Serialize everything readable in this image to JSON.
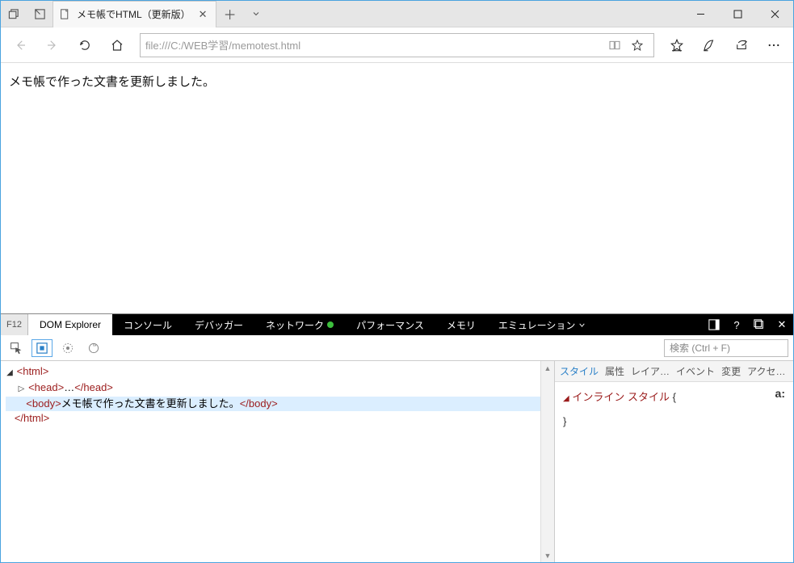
{
  "window": {
    "tab_title": "メモ帳でHTML（更新版）",
    "url": "file:///C:/WEB学習/memotest.html"
  },
  "page": {
    "body_text": "メモ帳で作った文書を更新しました。"
  },
  "devtools": {
    "f12_label": "F12",
    "tabs": {
      "dom": "DOM Explorer",
      "console": "コンソール",
      "debugger": "デバッガー",
      "network": "ネットワーク",
      "performance": "パフォーマンス",
      "memory": "メモリ",
      "emulation": "エミュレーション"
    },
    "search_placeholder": "検索 (Ctrl + F)",
    "dom": {
      "open_html": "<html>",
      "head_open": "<head>",
      "head_ellipsis": "…",
      "head_close": "</head>",
      "body_open": "<body>",
      "body_text": "メモ帳で作った文書を更新しました。",
      "body_close": "</body>",
      "close_html": "</html>"
    },
    "styles": {
      "tabs": {
        "style": "スタイル",
        "attr": "属性",
        "layout": "レイア…",
        "event": "イベント",
        "change": "変更",
        "access": "アクセ…"
      },
      "inline_label": "インライン スタイル",
      "open_brace": "{",
      "close_brace": "}",
      "a_colon": "a:"
    }
  }
}
